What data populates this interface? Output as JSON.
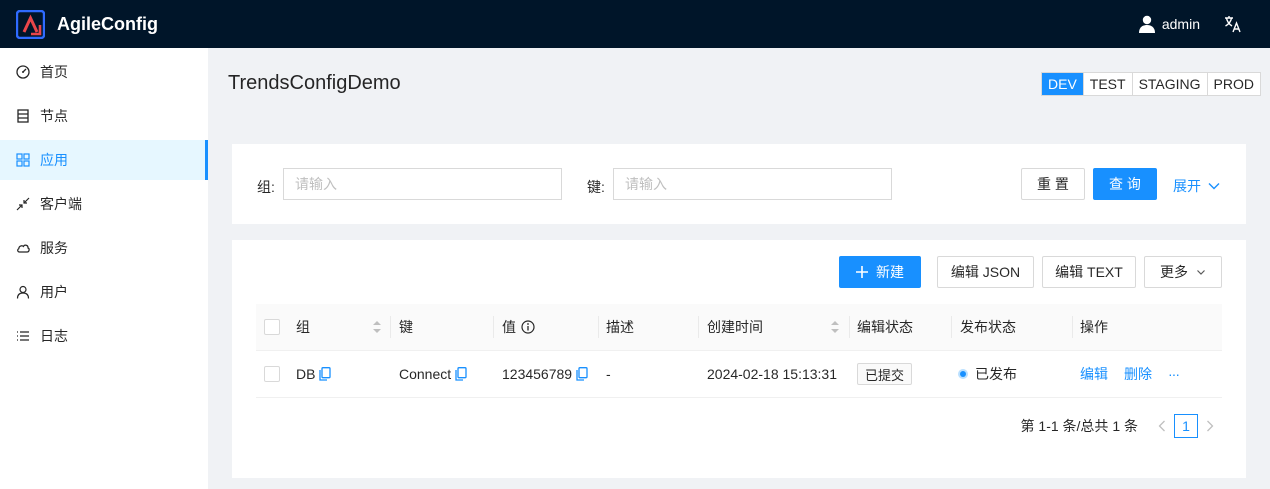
{
  "app": {
    "title": "AgileConfig"
  },
  "header": {
    "user": "admin",
    "lang_icon": "translate-icon"
  },
  "sidebar": {
    "items": [
      {
        "label": "首页",
        "icon": "dashboard-icon"
      },
      {
        "label": "节点",
        "icon": "database-icon"
      },
      {
        "label": "应用",
        "icon": "appstore-icon"
      },
      {
        "label": "客户端",
        "icon": "shrink-icon"
      },
      {
        "label": "服务",
        "icon": "cloud-icon"
      },
      {
        "label": "用户",
        "icon": "user-icon"
      },
      {
        "label": "日志",
        "icon": "list-icon"
      }
    ],
    "active_index": 2
  },
  "page": {
    "title": "TrendsConfigDemo"
  },
  "envs": {
    "items": [
      "DEV",
      "TEST",
      "STAGING",
      "PROD"
    ],
    "active": "DEV"
  },
  "search": {
    "group_label": "组",
    "group_placeholder": "请输入",
    "key_label": "键",
    "key_placeholder": "请输入",
    "reset_label": "重 置",
    "query_label": "查 询",
    "expand_label": "展开"
  },
  "toolbar": {
    "new_label": "新建",
    "edit_json_label": "编辑 JSON",
    "edit_text_label": "编辑 TEXT",
    "more_label": "更多"
  },
  "table": {
    "columns": [
      "组",
      "键",
      "值",
      "描述",
      "创建时间",
      "编辑状态",
      "发布状态",
      "操作"
    ],
    "rows": [
      {
        "group": "DB",
        "key": "Connect",
        "value": "123456789",
        "description": "-",
        "created": "2024-02-18 15:13:31",
        "edit_status": "已提交",
        "publish_status": "已发布",
        "actions": {
          "edit": "编辑",
          "delete": "删除",
          "more": "···"
        }
      }
    ]
  },
  "pagination": {
    "summary": "第 1-1 条/总共 1 条",
    "current": "1"
  },
  "colors": {
    "primary": "#1890ff",
    "header_bg": "#001529",
    "logo_red": "#e9464a",
    "logo_blue": "#2f5ee8"
  }
}
